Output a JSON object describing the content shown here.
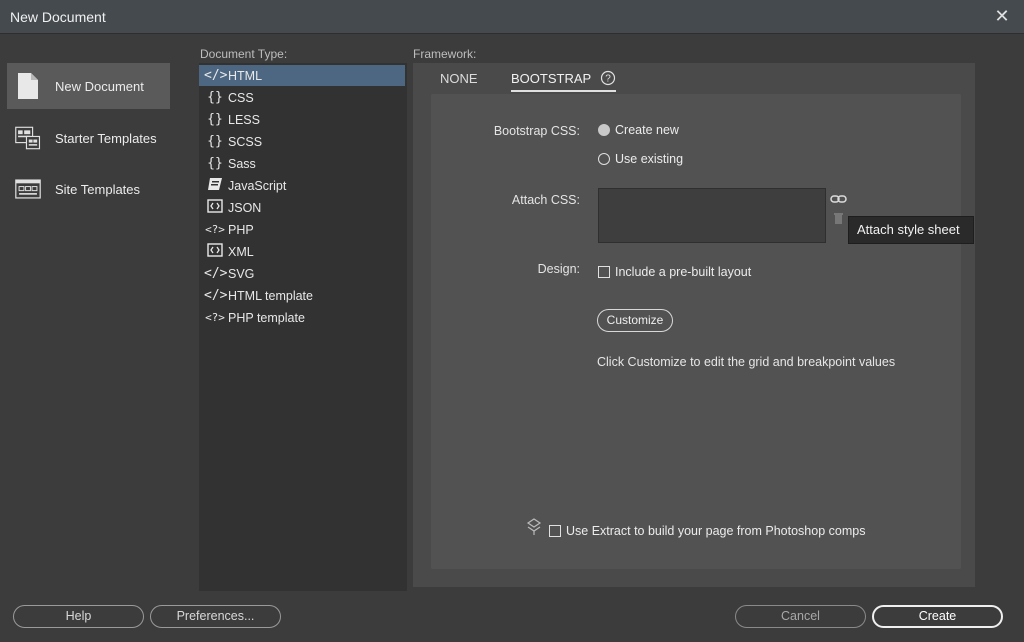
{
  "window": {
    "title": "New Document",
    "close_glyph": "✕"
  },
  "categories": [
    {
      "label": "New Document",
      "icon": "document-icon",
      "selected": true
    },
    {
      "label": "Starter Templates",
      "icon": "starter-templates-icon",
      "selected": false
    },
    {
      "label": "Site Templates",
      "icon": "site-templates-icon",
      "selected": false
    }
  ],
  "document_type": {
    "header": "Document Type:",
    "items": [
      {
        "label": "HTML",
        "icon": "</>",
        "selected": true
      },
      {
        "label": "CSS",
        "icon": "{}"
      },
      {
        "label": "LESS",
        "icon": "{}"
      },
      {
        "label": "SCSS",
        "icon": "{}"
      },
      {
        "label": "Sass",
        "icon": "{}"
      },
      {
        "label": "JavaScript",
        "icon": "js-scroll-icon"
      },
      {
        "label": "JSON",
        "icon": "json-icon"
      },
      {
        "label": "PHP",
        "icon": "<?>"
      },
      {
        "label": "XML",
        "icon": "xml-icon"
      },
      {
        "label": "SVG",
        "icon": "</>"
      },
      {
        "label": "HTML template",
        "icon": "</>"
      },
      {
        "label": "PHP template",
        "icon": "<?>"
      }
    ]
  },
  "framework": {
    "header": "Framework:",
    "tabs": {
      "none": "NONE",
      "bootstrap": "BOOTSTRAP",
      "active": "bootstrap"
    },
    "bootstrap_css": {
      "label": "Bootstrap CSS:",
      "create_new": "Create new",
      "use_existing": "Use existing",
      "selected": "create_new"
    },
    "attach_css": {
      "label": "Attach CSS:",
      "tooltip": "Attach style sheet"
    },
    "design": {
      "label": "Design:",
      "include_layout": "Include a pre-built layout",
      "checked": false
    },
    "customize_button": "Customize",
    "customize_hint": "Click Customize to edit the grid and breakpoint values",
    "extract": {
      "label": "Use Extract to build your page from Photoshop comps",
      "checked": false
    }
  },
  "buttons": {
    "help": "Help",
    "preferences": "Preferences...",
    "cancel": "Cancel",
    "create": "Create"
  },
  "colors": {
    "background": "#3c3c3c",
    "titlebar": "#454a4e",
    "selection": "#4d6682",
    "panel": "#4a4a4a"
  }
}
